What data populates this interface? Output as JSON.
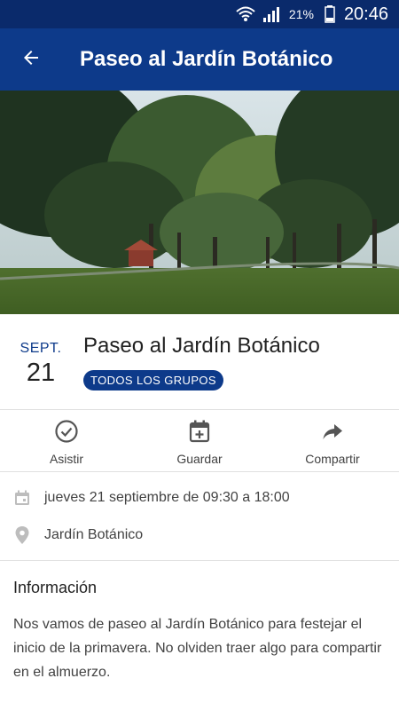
{
  "status_bar": {
    "battery": "21%",
    "time": "20:46"
  },
  "app_bar": {
    "title": "Paseo al Jardín Botánico"
  },
  "event": {
    "month": "SEPT.",
    "day": "21",
    "title": "Paseo al Jardín Botánico",
    "badge": "TODOS LOS GRUPOS"
  },
  "actions": [
    {
      "label": "Asistir",
      "icon": "check-circle-icon"
    },
    {
      "label": "Guardar",
      "icon": "calendar-add-icon"
    },
    {
      "label": "Compartir",
      "icon": "share-icon"
    }
  ],
  "details": {
    "datetime": "jueves 21 septiembre de 09:30 a 18:00",
    "location": "Jardín Botánico"
  },
  "info": {
    "heading": "Información",
    "body": "Nos vamos de paseo al Jardín Botánico para festejar el inicio de la primavera. No olviden traer algo para compartir en el almuerzo."
  },
  "colors": {
    "primary": "#0d3a8a",
    "status_bar": "#0a2a6b"
  }
}
